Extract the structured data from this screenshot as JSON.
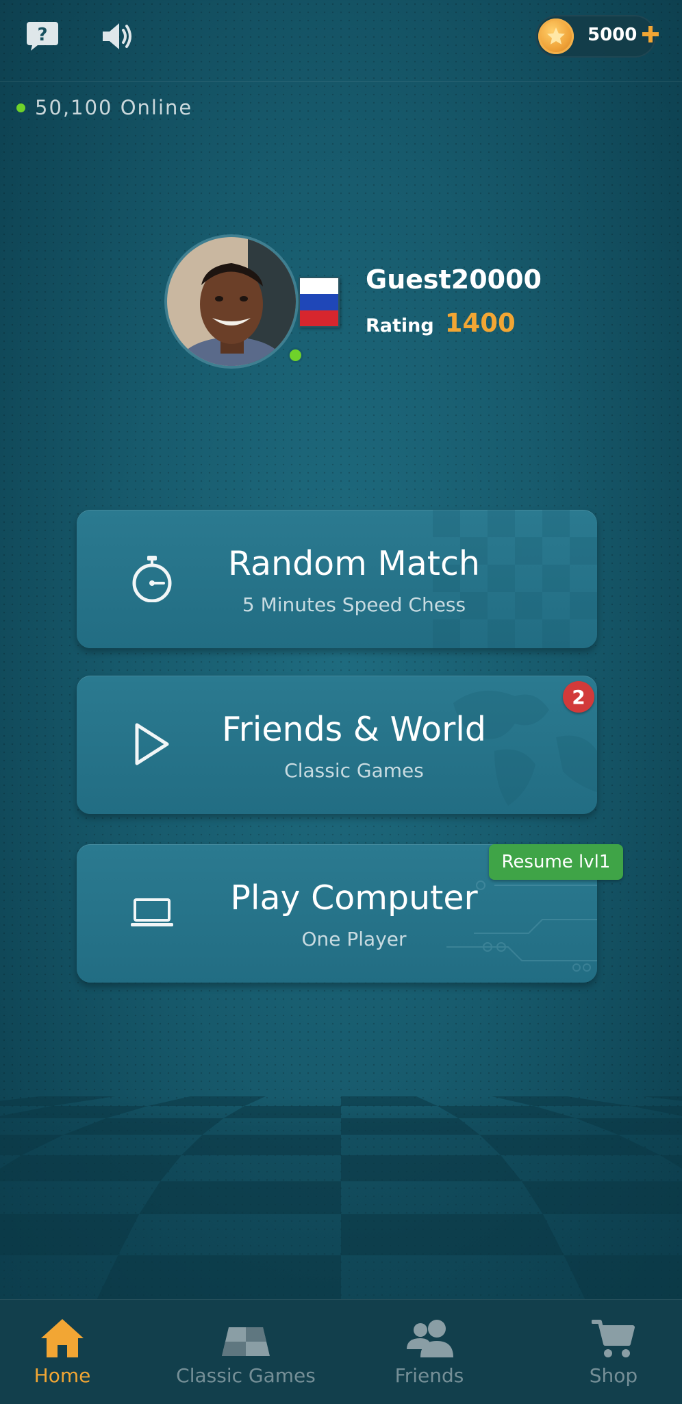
{
  "topbar": {
    "help_icon": "help-bubble-icon",
    "sound_icon": "speaker-icon",
    "coins": {
      "value": "5000",
      "icon": "coin-star-icon",
      "plus_icon": "plus-icon"
    }
  },
  "online": {
    "text": "50,100  Online",
    "dot_color": "#6fd22a"
  },
  "profile": {
    "username": "Guest20000",
    "rating_label": "Rating",
    "rating_value": "1400",
    "flag": "russia-flag",
    "status": "online"
  },
  "cards": [
    {
      "title": "Random Match",
      "subtitle": "5 Minutes Speed Chess",
      "icon": "stopwatch-icon"
    },
    {
      "title": "Friends & World",
      "subtitle": "Classic Games",
      "icon": "play-icon",
      "badge": "2"
    },
    {
      "title": "Play Computer",
      "subtitle": "One Player",
      "icon": "laptop-icon",
      "tag": "Resume lvl1"
    }
  ],
  "nav": {
    "items": [
      {
        "label": "Home",
        "icon": "home-icon",
        "active": true
      },
      {
        "label": "Classic Games",
        "icon": "chessboard-icon",
        "active": false
      },
      {
        "label": "Friends",
        "icon": "friends-icon",
        "active": false
      },
      {
        "label": "Shop",
        "icon": "cart-icon",
        "active": false
      }
    ]
  },
  "colors": {
    "accent": "#f2a634",
    "online": "#6fd22a",
    "badge": "#d23a3a",
    "resume": "#3fa447",
    "card": "#2b7a90",
    "background": "#175a6c"
  }
}
